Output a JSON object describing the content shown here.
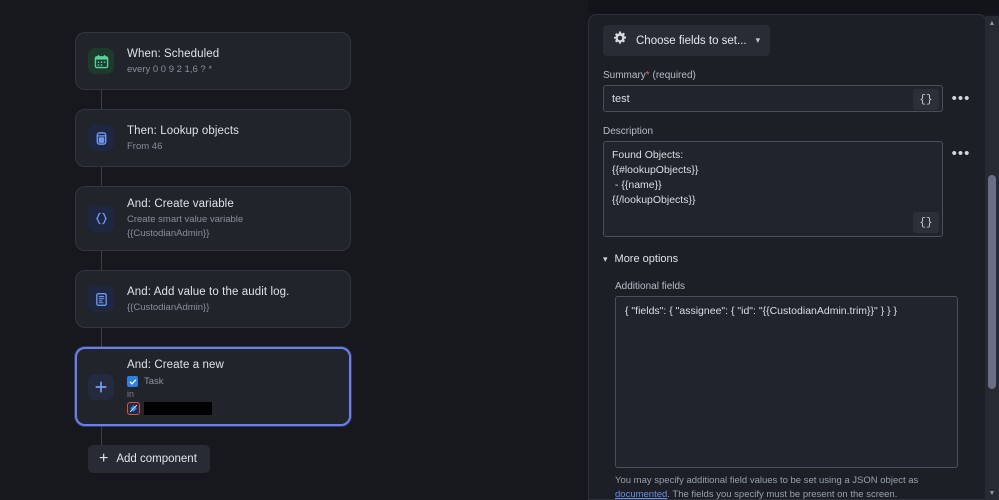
{
  "canvas": {
    "nodes": [
      {
        "title": "When: Scheduled",
        "subtitle": "every 0 0 9 2 1,6 ? *",
        "icon": "calendar-icon",
        "icon_color": "#5ad19a",
        "icon_bg": "#1d3a2c"
      },
      {
        "title": "Then: Lookup objects",
        "subtitle": "From 46",
        "icon": "database-icon",
        "icon_color": "#6e96f0",
        "icon_bg": "#1f2740"
      },
      {
        "title": "And: Create variable",
        "subtitle": "Create smart value variable",
        "subtitle2": "{{CustodianAdmin}}",
        "icon": "braces-icon",
        "icon_color": "#6e96f0",
        "icon_bg": "#1f2740"
      },
      {
        "title": "And: Add value to the audit log.",
        "subtitle": "{{CustodianAdmin}}",
        "icon": "audit-log-icon",
        "icon_color": "#6e96f0",
        "icon_bg": "#1f2740"
      }
    ],
    "selected_node": {
      "title": "And: Create a new",
      "icon": "plus-icon",
      "icon_color": "#6e96f0",
      "icon_bg": "#242b3f",
      "task_label": "Task",
      "in_label": "in",
      "project_redacted": true,
      "selection_color": "#6b7fe8"
    },
    "add_component_label": "Add component"
  },
  "panel": {
    "chooser": {
      "label": "Choose fields to set...",
      "icon": "gear-icon",
      "chevron": "chevron-down-icon"
    },
    "summary": {
      "label": "Summary",
      "required_marker": "*",
      "required_text": "(required)",
      "value": "test",
      "brace_label": "{}",
      "more_label": "•••"
    },
    "description": {
      "label": "Description",
      "value": "Found Objects:\n{{#lookupObjects}}\n - {{name}}\n{{/lookupObjects}}",
      "brace_label": "{}",
      "more_label": "•••"
    },
    "more_options": {
      "label": "More options",
      "chevron": "chevron-down-icon"
    },
    "additional_fields": {
      "label": "Additional fields",
      "value": "{ \"fields\": { \"assignee\": { \"id\": \"{{CustodianAdmin.trim}}\" } } }",
      "helper_pre": "You may specify additional field values to be set using a JSON object as ",
      "helper_link": "documented",
      "helper_post": ". The fields you specify must be present on the screen."
    }
  },
  "scrollbar": {
    "up_arrow": "chevron-up-icon",
    "down_arrow": "chevron-down-icon"
  }
}
